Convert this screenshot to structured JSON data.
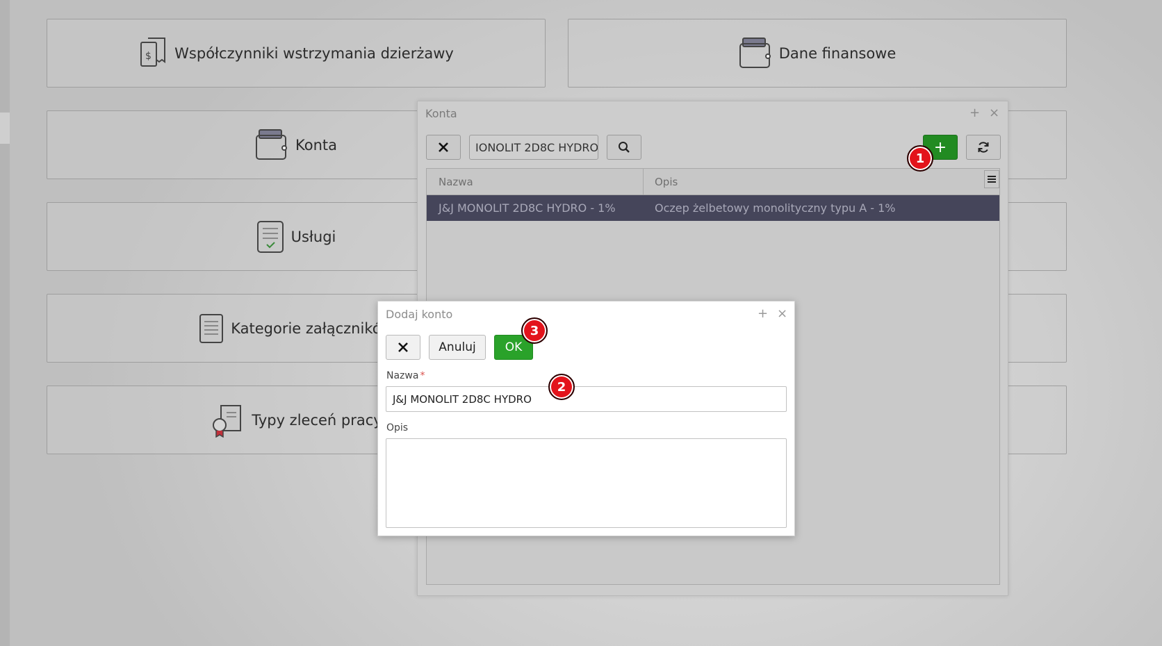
{
  "tiles": {
    "withholding": "Współczynniki wstrzymania dzierżawy",
    "financial": "Dane finansowe",
    "accounts": "Konta",
    "services": "Usługi",
    "attachment_categories": "Kategorie załączników",
    "work_order_types": "Typy zleceń pracy"
  },
  "konta_window": {
    "title": "Konta",
    "maximize": "+",
    "close": "×",
    "search_value": "IONOLIT 2D8C HYDRO",
    "add_label": "+",
    "columns": [
      "Nazwa",
      "Opis"
    ],
    "rows": [
      {
        "nazwa": "J&J MONOLIT 2D8C HYDRO - 1%",
        "opis": "Oczep żelbetowy monolityczny typu A - 1%"
      }
    ]
  },
  "dialog": {
    "title": "Dodaj konto",
    "maximize": "+",
    "close": "×",
    "cancel_label": "Anuluj",
    "ok_label": "OK",
    "name_label": "Nazwa",
    "required_mark": "*",
    "name_value": "J&J MONOLIT 2D8C HYDRO",
    "desc_label": "Opis",
    "desc_value": ""
  },
  "badges": {
    "b1": "1",
    "b2": "2",
    "b3": "3"
  },
  "colors": {
    "ok_green": "#2aa22a",
    "add_green": "#228b22",
    "selected_row": "#45455a",
    "badge_red": "#e3131b"
  }
}
